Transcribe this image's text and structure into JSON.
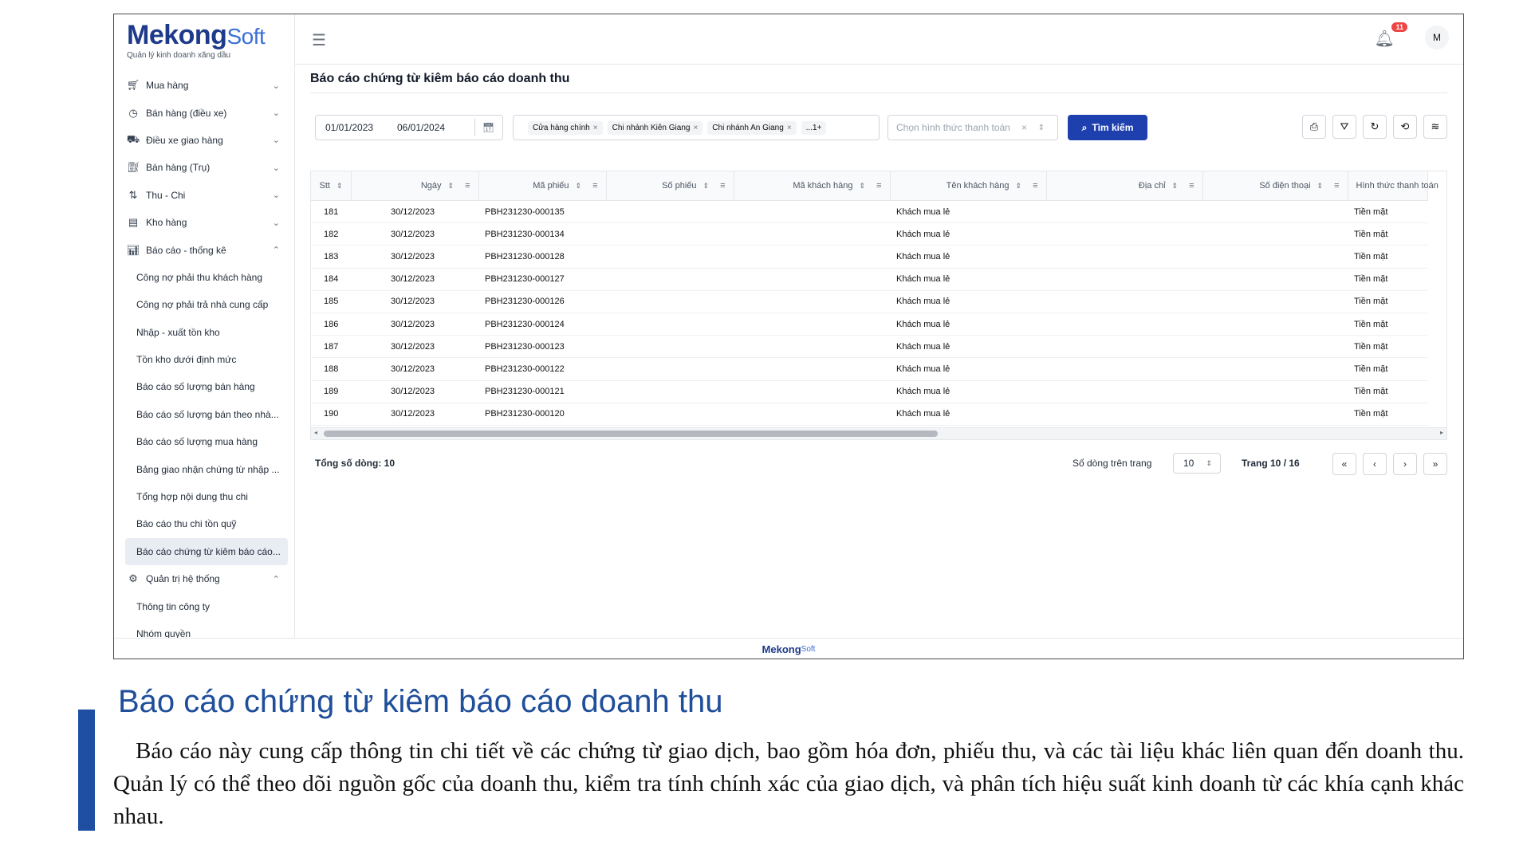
{
  "logo": {
    "brand_main": "Mekong",
    "brand_soft": "Soft",
    "tagline": "Quản lý kinh doanh xăng dầu"
  },
  "sidebar": {
    "items": [
      {
        "label": "Mua hàng",
        "icon": "cart-icon"
      },
      {
        "label": "Bán hàng (điều xe)",
        "icon": "gauge-icon"
      },
      {
        "label": "Điều xe giao hàng",
        "icon": "truck-icon"
      },
      {
        "label": "Bán hàng (Trụ)",
        "icon": "fuel-pump-icon"
      },
      {
        "label": "Thu - Chi",
        "icon": "transfer-icon"
      },
      {
        "label": "Kho hàng",
        "icon": "warehouse-icon"
      },
      {
        "label": "Báo cáo - thống kê",
        "icon": "bar-chart-icon"
      }
    ],
    "report_subitems": [
      "Công nợ phải thu khách hàng",
      "Công nợ phải trả nhà cung cấp",
      "Nhập - xuất tồn kho",
      "Tồn kho dưới định mức",
      "Báo cáo số lượng bán hàng",
      "Báo cáo số lượng bán theo nhà...",
      "Báo cáo số lượng mua hàng",
      "Bảng giao nhận chứng từ nhập ...",
      "Tổng hợp nội dung thu chi",
      "Báo cáo thu chi tồn quỹ",
      "Báo cáo chứng từ kiêm báo cáo..."
    ],
    "admin": {
      "label": "Quản trị hệ thống",
      "icon": "gear-icon"
    },
    "admin_subitems": [
      "Thông tin công ty",
      "Nhóm quyền"
    ]
  },
  "topbar": {
    "notification_count": "11",
    "avatar_initial": "M"
  },
  "page": {
    "title": "Báo cáo chứng từ kiêm báo cáo doanh thu"
  },
  "filters": {
    "date_from": "01/01/2023",
    "date_to": "06/01/2024",
    "stores": [
      "Cửa hàng chính",
      "Chi nhánh Kiên Giang",
      "Chi nhánh An Giang"
    ],
    "more_tag": "...1+",
    "payment_placeholder": "Chọn hình thức thanh toán",
    "search_label": "Tìm kiếm"
  },
  "table": {
    "columns": [
      "Stt",
      "Ngày",
      "Mã phiếu",
      "Số phiếu",
      "Mã khách hàng",
      "Tên khách hàng",
      "Địa chỉ",
      "Số điện thoại",
      "Hình thức thanh toán"
    ],
    "rows": [
      [
        "181",
        "30/12/2023",
        "PBH231230-000135",
        "",
        "",
        "Khách mua lẻ",
        "",
        "",
        "Tiền mặt"
      ],
      [
        "182",
        "30/12/2023",
        "PBH231230-000134",
        "",
        "",
        "Khách mua lẻ",
        "",
        "",
        "Tiền mặt"
      ],
      [
        "183",
        "30/12/2023",
        "PBH231230-000128",
        "",
        "",
        "Khách mua lẻ",
        "",
        "",
        "Tiền mặt"
      ],
      [
        "184",
        "30/12/2023",
        "PBH231230-000127",
        "",
        "",
        "Khách mua lẻ",
        "",
        "",
        "Tiền mặt"
      ],
      [
        "185",
        "30/12/2023",
        "PBH231230-000126",
        "",
        "",
        "Khách mua lẻ",
        "",
        "",
        "Tiền mặt"
      ],
      [
        "186",
        "30/12/2023",
        "PBH231230-000124",
        "",
        "",
        "Khách mua lẻ",
        "",
        "",
        "Tiền mặt"
      ],
      [
        "187",
        "30/12/2023",
        "PBH231230-000123",
        "",
        "",
        "Khách mua lẻ",
        "",
        "",
        "Tiền mặt"
      ],
      [
        "188",
        "30/12/2023",
        "PBH231230-000122",
        "",
        "",
        "Khách mua lẻ",
        "",
        "",
        "Tiền mặt"
      ],
      [
        "189",
        "30/12/2023",
        "PBH231230-000121",
        "",
        "",
        "Khách mua lẻ",
        "",
        "",
        "Tiền mặt"
      ],
      [
        "190",
        "30/12/2023",
        "PBH231230-000120",
        "",
        "",
        "Khách mua lẻ",
        "",
        "",
        "Tiền mặt"
      ]
    ]
  },
  "pagination": {
    "total_label": "Tổng số dòng: 10",
    "per_page_label": "Số dòng trên trang",
    "per_page_value": "10",
    "page_info": "Trang 10 / 16"
  },
  "document": {
    "heading": "Báo cáo chứng từ kiêm báo cáo doanh thu",
    "paragraph": "Báo cáo này cung cấp thông tin chi tiết về các chứng từ giao dịch, bao gồm hóa đơn, phiếu thu, và các tài liệu khác liên quan đến doanh thu. Quản lý có thể theo dõi nguồn gốc của doanh thu, kiểm tra tính chính xác của giao dịch, và phân tích hiệu suất kinh doanh từ các khía cạnh khác nhau.",
    "accent_color": "#1e4fa3"
  }
}
